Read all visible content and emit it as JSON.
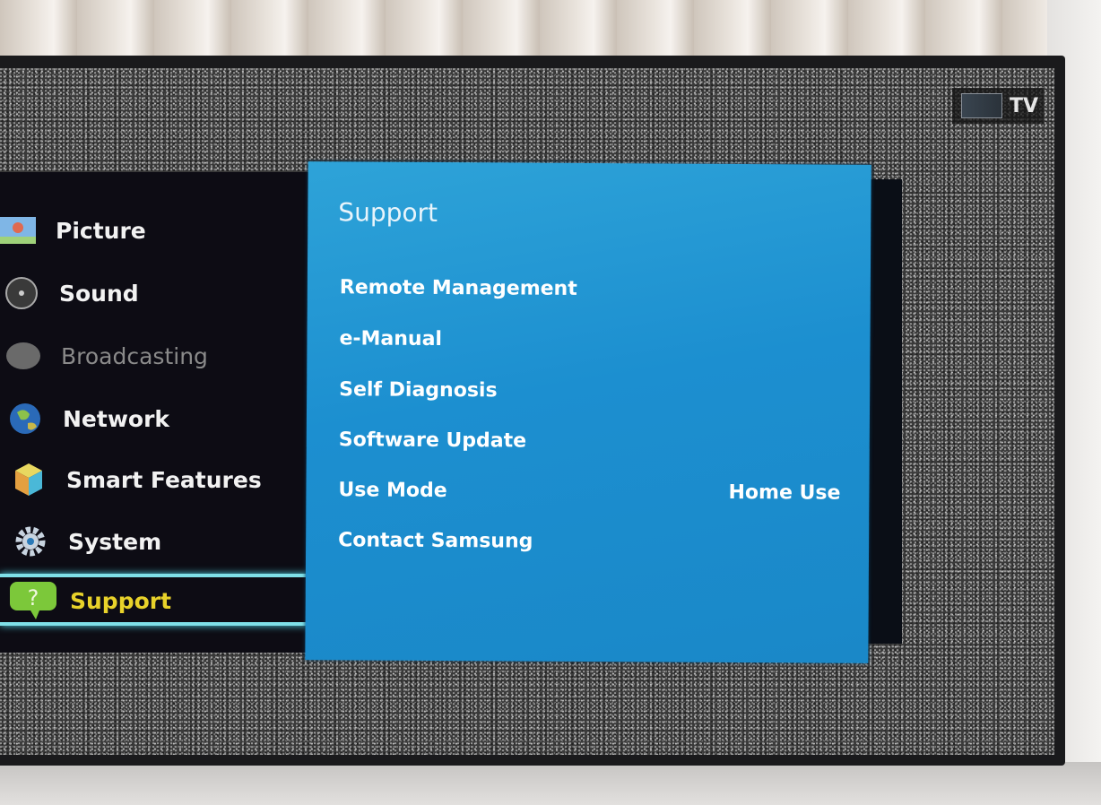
{
  "tv_badge": {
    "label": "TV",
    "icon": "tv-source-icon"
  },
  "sidebar": {
    "items": [
      {
        "label": "Picture",
        "icon": "picture-icon",
        "state": "normal"
      },
      {
        "label": "Sound",
        "icon": "speaker-icon",
        "state": "normal"
      },
      {
        "label": "Broadcasting",
        "icon": "satellite-dish-icon",
        "state": "disabled"
      },
      {
        "label": "Network",
        "icon": "globe-icon",
        "state": "normal"
      },
      {
        "label": "Smart Features",
        "icon": "cube-icon",
        "state": "normal"
      },
      {
        "label": "System",
        "icon": "gear-icon",
        "state": "normal"
      },
      {
        "label": "Support",
        "icon": "question-bubble-icon",
        "state": "selected"
      }
    ]
  },
  "support_panel": {
    "title": "Support",
    "options": [
      {
        "label": "Remote Management",
        "value": ""
      },
      {
        "label": "e-Manual",
        "value": ""
      },
      {
        "label": "Self Diagnosis",
        "value": ""
      },
      {
        "label": "Software Update",
        "value": ""
      },
      {
        "label": "Use Mode",
        "value": "Home Use"
      },
      {
        "label": "Contact Samsung",
        "value": ""
      }
    ]
  },
  "colors": {
    "panel_blue": "#1c8fd0",
    "selected_text": "#e8d22a",
    "highlight": "#7fe0e8"
  }
}
